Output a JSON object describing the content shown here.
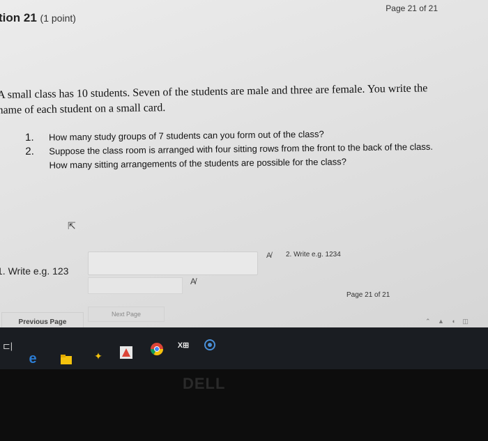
{
  "header": {
    "page_indicator_top": "Page 21 of 21",
    "question_prefix": "tion",
    "question_number": "21",
    "points": "(1 point)"
  },
  "question": {
    "text_line1": "A small class has 10 students. Seven of the students are male and three are female. You write the",
    "text_line2": "name of each student on a small card.",
    "items": [
      {
        "num": "1.",
        "lines": [
          "How many study groups of 7 students can you form out of the class?"
        ]
      },
      {
        "num": "2.",
        "lines": [
          "Suppose the class room is arranged with four sitting rows from the front to the back of the class.",
          "How many sitting arrangements of the students are possible for the class?"
        ]
      }
    ]
  },
  "answers": {
    "a1_label": "1. Write e.g. 123",
    "a1_value": "",
    "a2_label": "2. Write e.g. 1234",
    "a2_value": ""
  },
  "footer": {
    "page_indicator_bottom": "Page 21 of 21",
    "previous_label": "Previous Page",
    "next_label": "Next Page"
  },
  "laptop": {
    "brand": "DELL"
  },
  "colors": {
    "edge_blue": "#2b7cd3",
    "chrome_yellow": "#f4c20d",
    "chrome_red": "#db4437",
    "chrome_green": "#0f9d58",
    "taskbar": "#1a1d22"
  }
}
